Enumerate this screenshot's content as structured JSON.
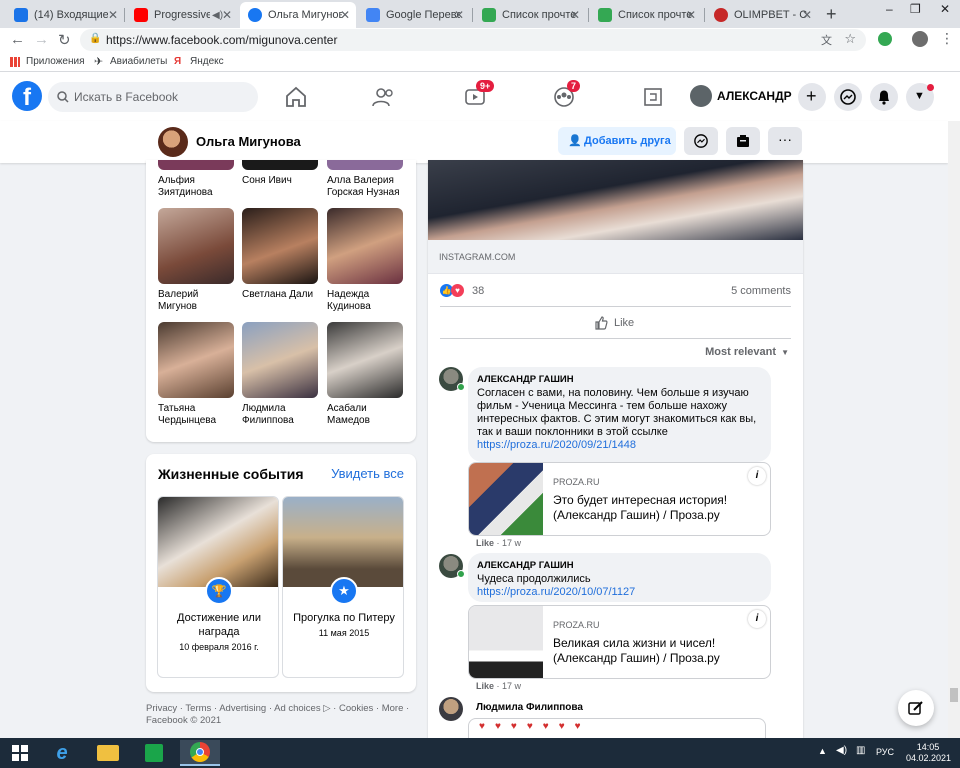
{
  "browser": {
    "tabs": [
      {
        "label": "(14) Входящие -",
        "color": "#1a73e8"
      },
      {
        "label": "Progressive",
        "color": "#ff0000"
      },
      {
        "label": "Ольга Мигунова",
        "color": "#1877f2"
      },
      {
        "label": "Google Перевод",
        "color": "#4285f4"
      },
      {
        "label": "Список прочтен",
        "color": "#34a853"
      },
      {
        "label": "Список прочтен",
        "color": "#34a853"
      },
      {
        "label": "OLIMPBET - Спо",
        "color": "#c62828"
      }
    ],
    "url": "https://www.facebook.com/migunova.center",
    "bookmarks": [
      "Приложения",
      "Авиабилеты",
      "Яндекс"
    ]
  },
  "fb": {
    "search_placeholder": "Искать в Facebook",
    "video_badge": "9+",
    "groups_badge": "7",
    "user_name": "АЛЕКСАНДР"
  },
  "profile": {
    "name": "Ольга Мигунова",
    "add_friend": "Добавить друга"
  },
  "friends": [
    {
      "name": "Альфия Зиятдинова"
    },
    {
      "name": "Соня Ивич"
    },
    {
      "name": "Алла Валерия Горская Нузная"
    },
    {
      "name": "Валерий Мигунов"
    },
    {
      "name": "Светлана Дали"
    },
    {
      "name": "Надежда Кудинова"
    },
    {
      "name": "Татьяна Чердынцева"
    },
    {
      "name": "Людмила Филиппова"
    },
    {
      "name": "Асабали Мамедов"
    }
  ],
  "life_events": {
    "title": "Жизненные события",
    "see_all": "Увидеть все",
    "items": [
      {
        "title": "Достижение или награда",
        "date": "10 февраля 2016 г."
      },
      {
        "title": "Прогулка по Питеру",
        "date": "11 мая 2015"
      }
    ]
  },
  "footer": {
    "line1": "Privacy · Terms · Advertising · Ad choices ▷ · Cookies · More ·",
    "line2": "Facebook © 2021"
  },
  "post": {
    "source": "INSTAGRAM.COM",
    "reactions_count": "38",
    "comments_count": "5 comments",
    "like_label": "Like",
    "sort_label": "Most relevant",
    "comments": [
      {
        "author": "АЛЕКСАНДР ГАШИН",
        "text": "Согласен с вами, на половину. Чем больше я изучаю фильм - Ученица Мессинга - тем больше нахожу интересных фактов. С этим могут знакомиться как вы, так и ваши поклонники в этой ссылке",
        "link": "https://proza.ru/2020/09/21/1448",
        "card_domain": "PROZA.RU",
        "card_title": "Это будет интересная история! (Александр Гашин) / Проза.ру",
        "meta_like": "Like",
        "meta_time": "· 17 w"
      },
      {
        "author": "АЛЕКСАНДР ГАШИН",
        "text": "Чудеса продолжились",
        "link": "https://proza.ru/2020/10/07/1127",
        "card_domain": "PROZA.RU",
        "card_title": "Великая сила жизни и чисел! (Александр Гашин) / Проза.ру",
        "meta_like": "Like",
        "meta_time": "· 17 w"
      },
      {
        "author": "Людмила Филиппова"
      }
    ]
  },
  "taskbar": {
    "lang": "РУС",
    "time": "14:05",
    "date": "04.02.2021"
  }
}
